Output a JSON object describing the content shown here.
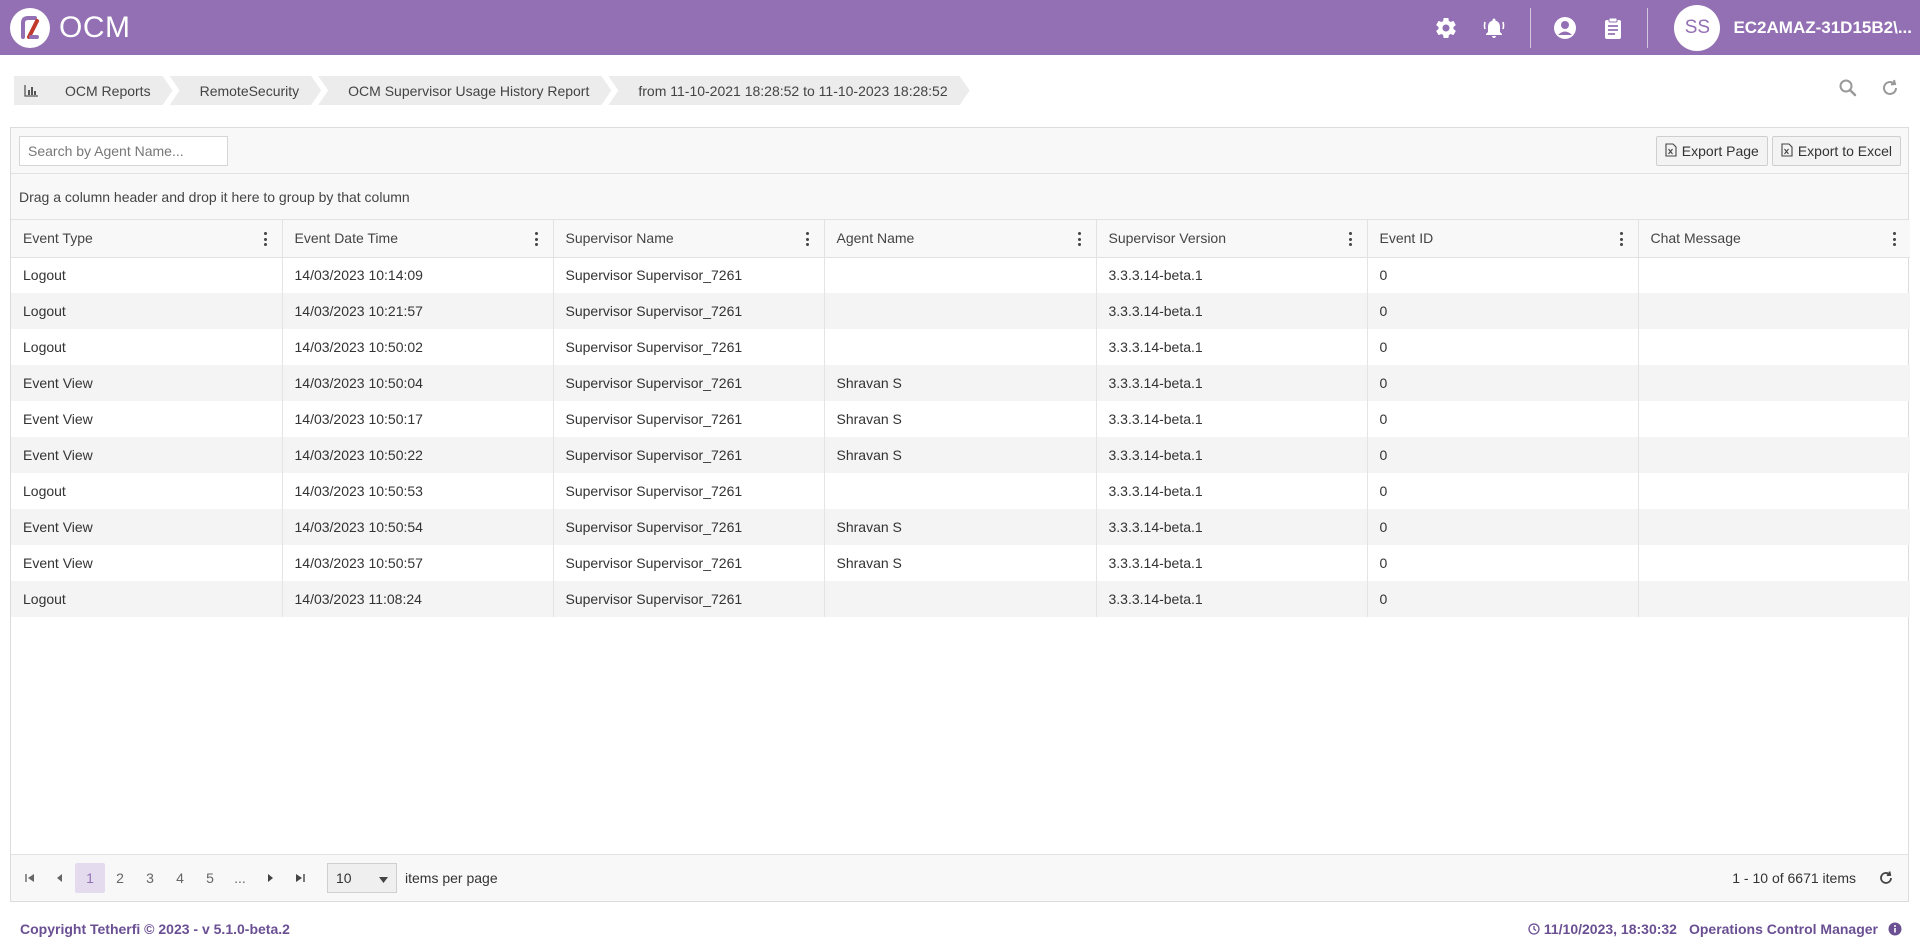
{
  "app": {
    "title": "OCM",
    "user_initials": "SS",
    "username": "EC2AMAZ-31D15B2\\..."
  },
  "colors": {
    "brand": "#9370b3",
    "footer_text": "#6a4f93",
    "active_page_bg": "#e4dcee"
  },
  "header": {
    "icons": [
      "settings-gear-icon",
      "notification-bell-icon",
      "user-circle-icon",
      "clipboard-icon"
    ]
  },
  "breadcrumb": {
    "items": [
      "OCM Reports",
      "RemoteSecurity",
      "OCM Supervisor Usage History Report",
      "from 11-10-2021 18:28:52 to 11-10-2023 18:28:52"
    ]
  },
  "toolbar": {
    "search_placeholder": "Search by Agent Name...",
    "export_page": "Export Page",
    "export_excel": "Export to Excel",
    "group_hint": "Drag a column header and drop it here to group by that column"
  },
  "table": {
    "columns": [
      "Event Type",
      "Event Date Time",
      "Supervisor Name",
      "Agent Name",
      "Supervisor Version",
      "Event ID",
      "Chat Message"
    ],
    "rows": [
      [
        "Logout",
        "14/03/2023 10:14:09",
        "Supervisor Supervisor_7261",
        "",
        "3.3.3.14-beta.1",
        "0",
        ""
      ],
      [
        "Logout",
        "14/03/2023 10:21:57",
        "Supervisor Supervisor_7261",
        "",
        "3.3.3.14-beta.1",
        "0",
        ""
      ],
      [
        "Logout",
        "14/03/2023 10:50:02",
        "Supervisor Supervisor_7261",
        "",
        "3.3.3.14-beta.1",
        "0",
        ""
      ],
      [
        "Event View",
        "14/03/2023 10:50:04",
        "Supervisor Supervisor_7261",
        "Shravan S",
        "3.3.3.14-beta.1",
        "0",
        ""
      ],
      [
        "Event View",
        "14/03/2023 10:50:17",
        "Supervisor Supervisor_7261",
        "Shravan S",
        "3.3.3.14-beta.1",
        "0",
        ""
      ],
      [
        "Event View",
        "14/03/2023 10:50:22",
        "Supervisor Supervisor_7261",
        "Shravan S",
        "3.3.3.14-beta.1",
        "0",
        ""
      ],
      [
        "Logout",
        "14/03/2023 10:50:53",
        "Supervisor Supervisor_7261",
        "",
        "3.3.3.14-beta.1",
        "0",
        ""
      ],
      [
        "Event View",
        "14/03/2023 10:50:54",
        "Supervisor Supervisor_7261",
        "Shravan S",
        "3.3.3.14-beta.1",
        "0",
        ""
      ],
      [
        "Event View",
        "14/03/2023 10:50:57",
        "Supervisor Supervisor_7261",
        "Shravan S",
        "3.3.3.14-beta.1",
        "0",
        ""
      ],
      [
        "Logout",
        "14/03/2023 11:08:24",
        "Supervisor Supervisor_7261",
        "",
        "3.3.3.14-beta.1",
        "0",
        ""
      ]
    ]
  },
  "pager": {
    "pages": [
      "1",
      "2",
      "3",
      "4",
      "5",
      "..."
    ],
    "active_page": "1",
    "page_size": "10",
    "per_page_label": "items per page",
    "info": "1 - 10 of 6671 items"
  },
  "footer": {
    "copyright": "Copyright Tetherfi © 2023 - v 5.1.0-beta.2",
    "datetime": "11/10/2023, 18:30:32",
    "product": "Operations Control Manager"
  }
}
